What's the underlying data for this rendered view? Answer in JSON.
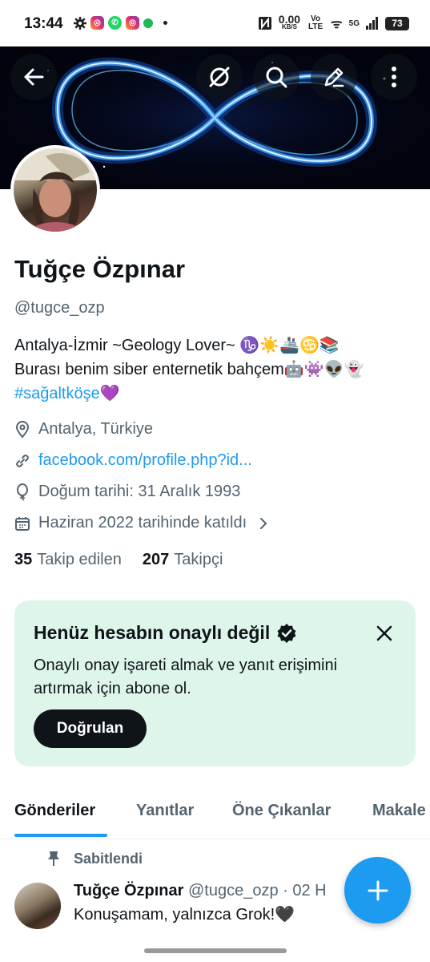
{
  "status_bar": {
    "time": "13:44",
    "net_speed": "0.00",
    "net_unit": "KB/S",
    "volte": "Vo LTE",
    "signal": "5G",
    "battery": "73"
  },
  "header": {
    "icons": [
      "back-arrow-icon",
      "grok-icon",
      "search-icon",
      "edit-icon",
      "more-icon"
    ]
  },
  "profile": {
    "name": "Tuğçe Özpınar",
    "handle": "@tugce_ozp",
    "bio_line1": "Antalya-İzmir ~Geology Lover~ ♑☀️🚢♋📚",
    "bio_line2": "Burası benim siber enternetik bahçem🤖👾👽👻",
    "bio_hashtag": "#sağaltköşe",
    "bio_hashtag_emoji": "💜",
    "location": "Antalya, Türkiye",
    "website": "facebook.com/profile.php?id...",
    "birthday": "Doğum tarihi: 31 Aralık 1993",
    "joined": "Haziran 2022 tarihinde katıldı",
    "following_count": "35",
    "following_label": "Takip edilen",
    "followers_count": "207",
    "followers_label": "Takipçi"
  },
  "promo": {
    "title": "Henüz hesabın onaylı değil",
    "text": "Onaylı onay işareti almak ve yanıt erişimini artırmak için abone ol.",
    "button": "Doğrulan"
  },
  "tabs": [
    {
      "label": "Gönderiler",
      "active": true
    },
    {
      "label": "Yanıtlar",
      "active": false
    },
    {
      "label": "Öne Çıkanlar",
      "active": false
    },
    {
      "label": "Makale",
      "active": false
    }
  ],
  "post": {
    "pinned_label": "Sabitlendi",
    "author": "Tuğçe Özpınar",
    "meta": "@tugce_ozp · 02 H",
    "text": "Konuşamam, yalnızca Grok!🖤"
  },
  "colors": {
    "accent": "#1d9bf0",
    "promo_bg": "#def5ea",
    "text": "#0f1419",
    "secondary": "#536471"
  }
}
